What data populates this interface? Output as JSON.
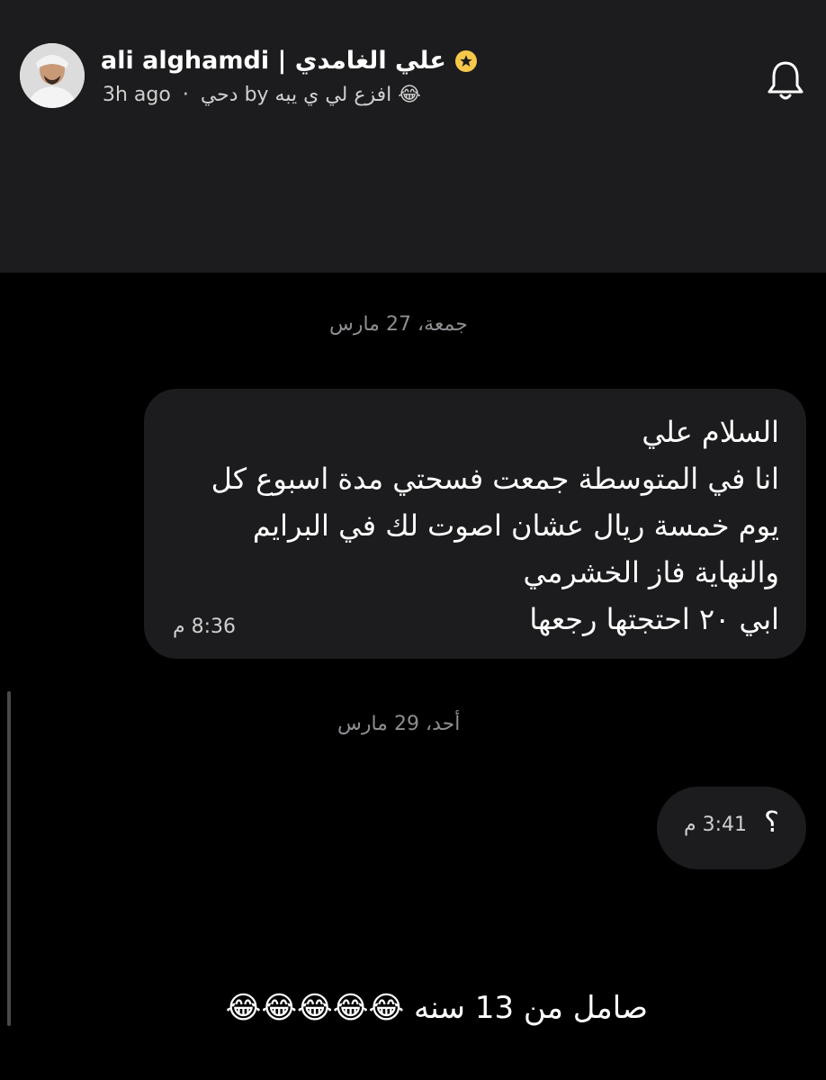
{
  "story": {
    "user_name": "ali alghamdi | علي الغامدي",
    "time_ago": "3h ago",
    "separator": "·",
    "caption_line": "😂 افزع لي ي يبه by دحي"
  },
  "icons": {
    "avatar": "user-avatar",
    "verified": "star-badge-icon",
    "notify": "bell-icon"
  },
  "chat": {
    "date_1": "جمعة، 27 مارس",
    "message_1": {
      "lines": [
        "السلام علي",
        "انا في المتوسطة جمعت فسحتي مدة اسبوع كل",
        "يوم خمسة ريال عشان اصوت لك في البرايم",
        "والنهاية فاز الخشرمي",
        "ابي ٢٠ احتجتها رجعها"
      ],
      "time": "8:36 م"
    },
    "date_2": "أحد، 29 مارس",
    "message_2": {
      "text": "؟",
      "time": "3:41 م"
    }
  },
  "overlay_caption": "صامل من 13 سنه 😂😂😂😂😂",
  "colors": {
    "background": "#000000",
    "header_bg": "#1c1c1e",
    "bubble_bg": "#1c1c1e",
    "badge": "#f5c84a",
    "muted_text": "#8e8e93"
  }
}
